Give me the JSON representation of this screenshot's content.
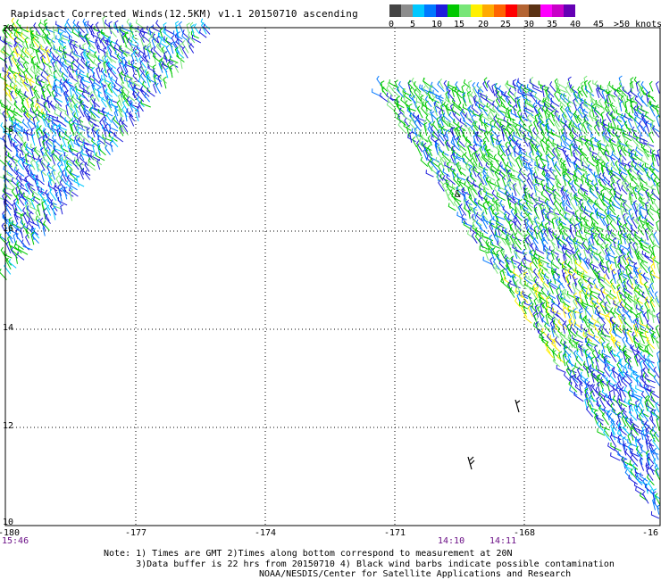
{
  "header": {
    "title": "Rapidsact Corrected Winds(12.5KM) v1.1 20150710 ascending"
  },
  "legend": {
    "colors": [
      "#444444",
      "#8c8c8c",
      "#00c8ff",
      "#0078ff",
      "#1e1edc",
      "#00c800",
      "#78e678",
      "#fff000",
      "#ffaa00",
      "#ff6400",
      "#ff0000",
      "#b46432",
      "#5a3214",
      "#ff00ff",
      "#c800c8",
      "#6400b4"
    ],
    "labels": [
      "0",
      "5",
      "10",
      "15",
      "20",
      "25",
      "30",
      "35",
      "40",
      "45",
      ">50 knots"
    ]
  },
  "map": {
    "lat_labels": [
      "20",
      "18",
      "16",
      "14",
      "12",
      "10"
    ],
    "lon_labels": [
      "-180",
      "-177",
      "-174",
      "-171",
      "-168",
      "-16"
    ],
    "time_labels": [
      "15:46",
      "14:10",
      "14:11"
    ],
    "island_label": "&"
  },
  "notes": {
    "line1": "Note: 1) Times are GMT 2)Times along bottom correspond to measurement at 20N",
    "line2": "      3)Data buffer is 22 hrs from 20150710 4) Black wind barbs indicate possible contamination"
  },
  "credit": "NOAA/NESDIS/Center for Satellite Applications and Research"
}
